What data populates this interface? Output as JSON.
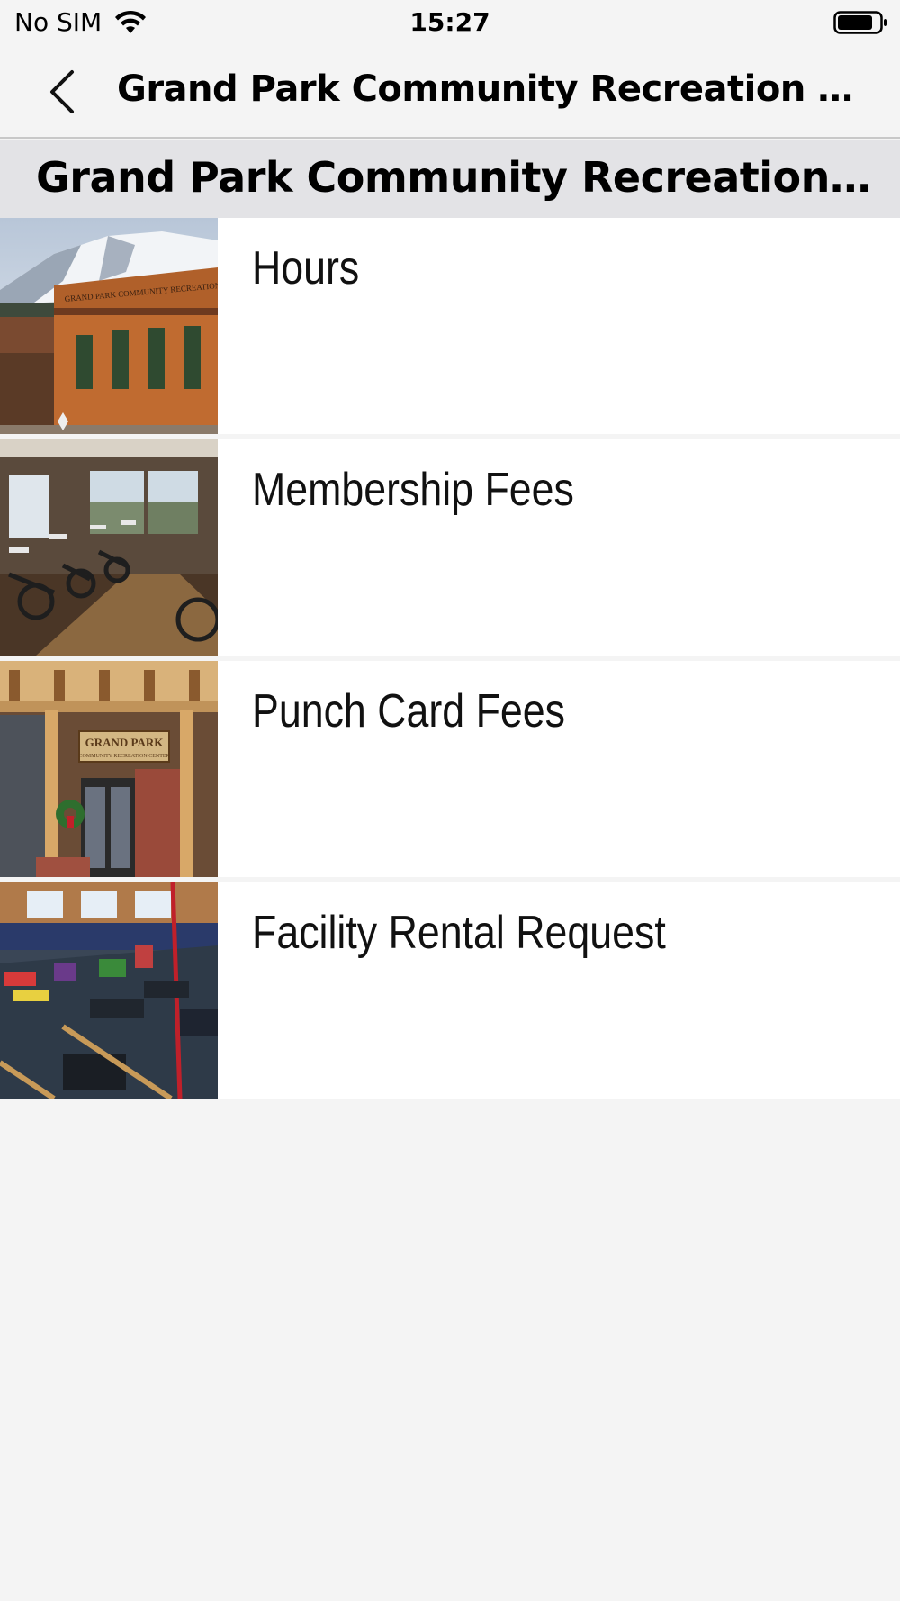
{
  "status_bar": {
    "carrier": "No SIM",
    "time": "15:27"
  },
  "nav": {
    "title": "Grand Park Community Recreation Center"
  },
  "section": {
    "title": "Grand Park Community Recreation Cent..."
  },
  "items": [
    {
      "label": "Hours",
      "image": "building-exterior-photo"
    },
    {
      "label": "Membership Fees",
      "image": "spin-bikes-room-photo"
    },
    {
      "label": "Punch Card Fees",
      "image": "entrance-doors-photo"
    },
    {
      "label": "Facility Rental Request",
      "image": "gymnastics-room-photo"
    }
  ],
  "thumb_signs": {
    "building": "GRAND PARK COMMUNITY RECREATION CENTER",
    "entrance_1": "GRAND PARK",
    "entrance_2": "COMMUNITY RECREATION CENTER"
  },
  "colors": {
    "background": "#f4f4f4",
    "section_header": "#e3e3e6",
    "row": "#ffffff"
  }
}
